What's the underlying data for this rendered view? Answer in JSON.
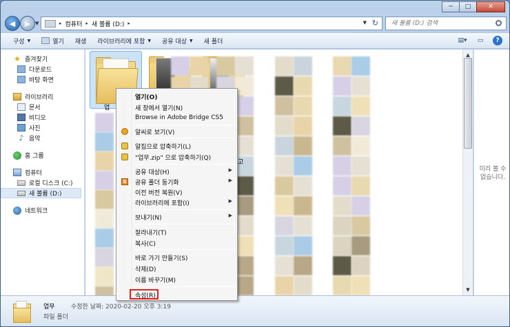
{
  "window": {
    "caption": {
      "minimize": "─",
      "maximize": "□",
      "close": "✕"
    }
  },
  "address": {
    "segments": [
      "컴퓨터",
      "새 볼륨 (D:)"
    ],
    "separator": "▸",
    "refresh": "↻"
  },
  "search": {
    "placeholder": "새 볼륨 (D:) 검색"
  },
  "toolbar": {
    "organize": "구성",
    "open": "열기",
    "share_label": "재생",
    "burn": "라이브러리에 포함",
    "share_with": "공유 대상",
    "new_folder": "새 폴더"
  },
  "navpane": {
    "favorites": "즐겨찾기",
    "downloads": "다운로드",
    "desktop": "바탕 화면",
    "libraries": "라이브러리",
    "documents": "문서",
    "videos": "비디오",
    "pictures": "사진",
    "music": "음악",
    "homegroup": "홈 그룹",
    "computer": "컴퓨터",
    "local_disk": "로컬 디스크 (C:)",
    "new_volume": "새 볼륨 (D:)",
    "network": "네트워크"
  },
  "content": {
    "selected_folder_label": "업",
    "partial_label": "고"
  },
  "context_menu": {
    "items": [
      {
        "label": "열기(O)",
        "bold": true
      },
      {
        "label": "새 창에서 열기(N)"
      },
      {
        "label": "Browse in Adobe Bridge CS5"
      },
      {
        "label": "알씨로 보기(V)"
      },
      {
        "label": "알집으로 압축하기(L)"
      },
      {
        "label": "\"업무.zip\" 으로 압축하기(Q)"
      },
      {
        "label": "공유 대상(H)",
        "submenu": true
      },
      {
        "label": "공유 폴더 동기화",
        "submenu": true
      },
      {
        "label": "이전 버전 복원(V)"
      },
      {
        "label": "라이브러리에 포함(I)",
        "submenu": true
      },
      {
        "label": "보내기(N)",
        "submenu": true
      },
      {
        "label": "잘라내기(T)"
      },
      {
        "label": "복사(C)"
      },
      {
        "label": "바로 가기 만들기(S)"
      },
      {
        "label": "삭제(D)"
      },
      {
        "label": "이름 바꾸기(M)"
      },
      {
        "label": "속성(R)"
      }
    ],
    "highlighted": "속성(R)"
  },
  "preview": {
    "text": "미리 볼 수\n없습니다."
  },
  "details": {
    "name": "업무",
    "date_label": "수정한 날짜: 2020-02-20 오후 3:19",
    "type": "파일 폴더"
  },
  "colors": {
    "highlight_box": "#e02020",
    "selection": "#cce2f7"
  }
}
